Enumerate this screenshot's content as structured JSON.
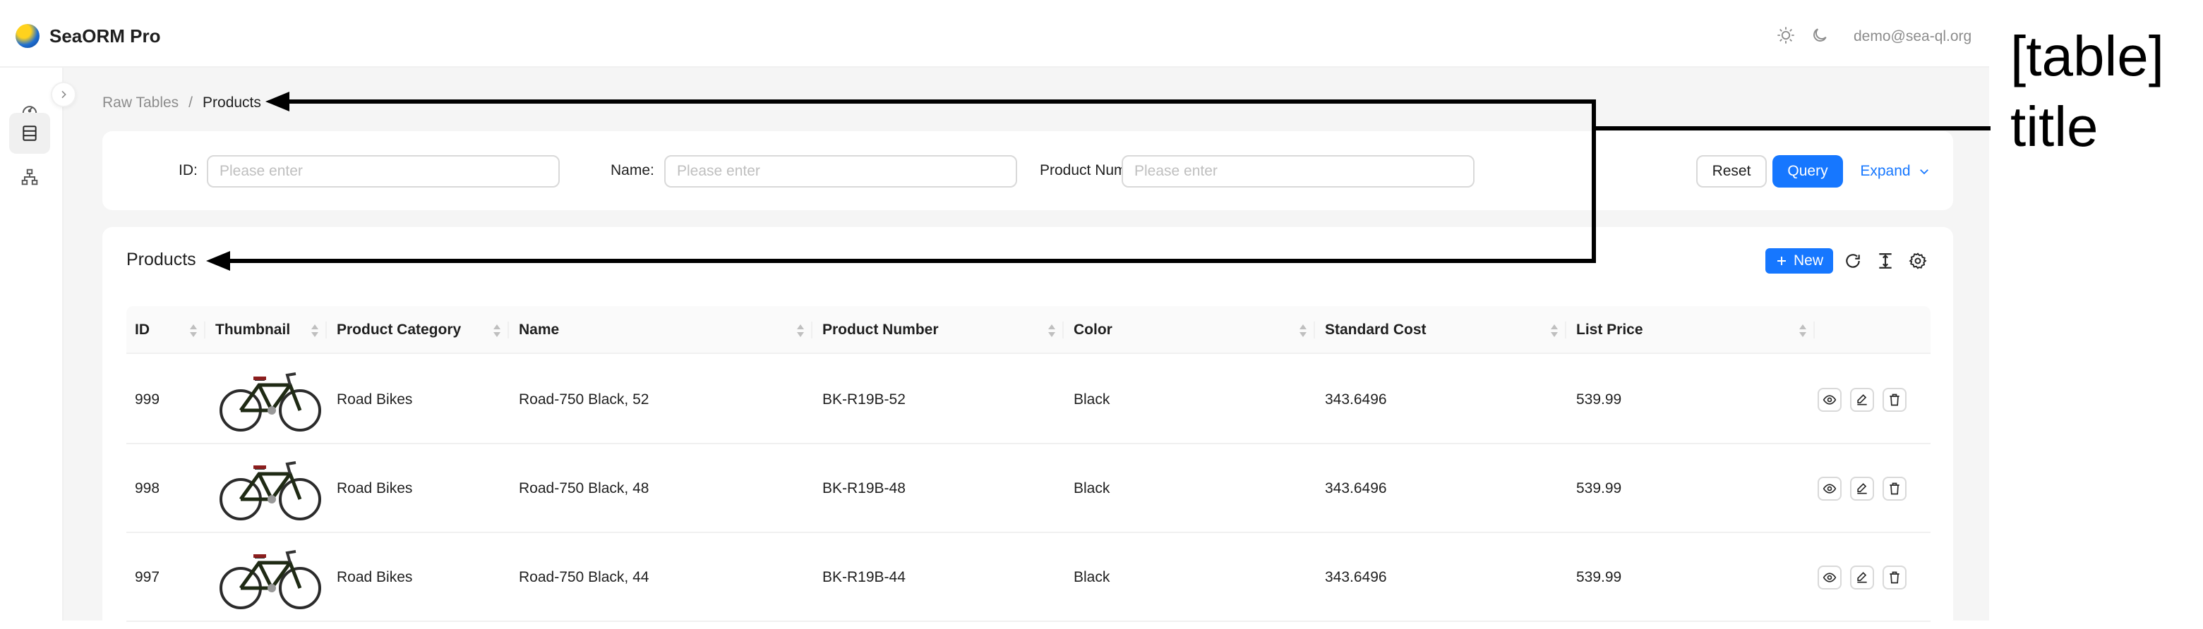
{
  "header": {
    "app_title": "SeaORM Pro",
    "user_email": "demo@sea-ql.org"
  },
  "sidebar": {
    "items": [
      {
        "icon": "dashboard-icon"
      },
      {
        "icon": "table-icon",
        "active": true
      },
      {
        "icon": "sitemap-icon"
      }
    ]
  },
  "breadcrumb": {
    "parent": "Raw Tables",
    "separator": "/",
    "current": "Products"
  },
  "search": {
    "fields": [
      {
        "label": "ID",
        "colon": ":",
        "placeholder": "Please enter"
      },
      {
        "label": "Name",
        "colon": ":",
        "placeholder": "Please enter"
      },
      {
        "label": "Product Num",
        "placeholder": "Please enter"
      }
    ],
    "reset_label": "Reset",
    "query_label": "Query",
    "expand_label": "Expand"
  },
  "table": {
    "title": "Products",
    "new_label": "New",
    "columns": [
      "ID",
      "Thumbnail",
      "Product Category",
      "Name",
      "Product Number",
      "Color",
      "Standard Cost",
      "List Price"
    ],
    "rows": [
      {
        "id": "999",
        "category": "Road Bikes",
        "name": "Road-750 Black, 52",
        "number": "BK-R19B-52",
        "color": "Black",
        "cost": "343.6496",
        "price": "539.99"
      },
      {
        "id": "998",
        "category": "Road Bikes",
        "name": "Road-750 Black, 48",
        "number": "BK-R19B-48",
        "color": "Black",
        "cost": "343.6496",
        "price": "539.99"
      },
      {
        "id": "997",
        "category": "Road Bikes",
        "name": "Road-750 Black, 44",
        "number": "BK-R19B-44",
        "color": "Black",
        "cost": "343.6496",
        "price": "539.99"
      }
    ]
  },
  "annotation": {
    "line1": "[table]",
    "line2": "title"
  },
  "colors": {
    "primary": "#1677ff",
    "header_bg": "#fafafa",
    "page_bg": "#f5f5f5"
  }
}
